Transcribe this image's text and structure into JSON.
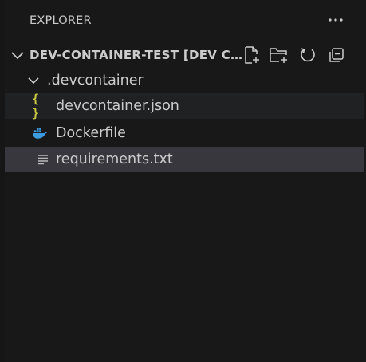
{
  "header": {
    "title": "EXPLORER",
    "more_icon": "ellipsis-icon"
  },
  "workspace": {
    "title": "DEV-CONTAINER-TEST [DEV CONTAINER]",
    "chevron_icon": "chevron-down-icon",
    "actions": [
      {
        "name": "new-file",
        "icon": "new-file-icon"
      },
      {
        "name": "new-folder",
        "icon": "new-folder-icon"
      },
      {
        "name": "refresh",
        "icon": "refresh-icon"
      },
      {
        "name": "collapse-all",
        "icon": "collapse-all-icon"
      }
    ]
  },
  "tree": [
    {
      "label": ".devcontainer",
      "type": "folder",
      "expanded": true,
      "icon": "chevron-down-icon"
    },
    {
      "label": "devcontainer.json",
      "type": "file",
      "icon": "json-icon",
      "icon_glyph": "{ }",
      "icon_color": "#cbcb41",
      "highlight": "hover"
    },
    {
      "label": "Dockerfile",
      "type": "file",
      "icon": "docker-icon",
      "icon_color": "#3d9ce0"
    },
    {
      "label": "requirements.txt",
      "type": "file",
      "icon": "text-lines-icon",
      "icon_color": "#bbbbbb",
      "highlight": "selected"
    }
  ],
  "colors": {
    "background": "#181818",
    "text": "#cccccc",
    "hover_row": "#1f2123",
    "selected_row": "#37373d"
  }
}
